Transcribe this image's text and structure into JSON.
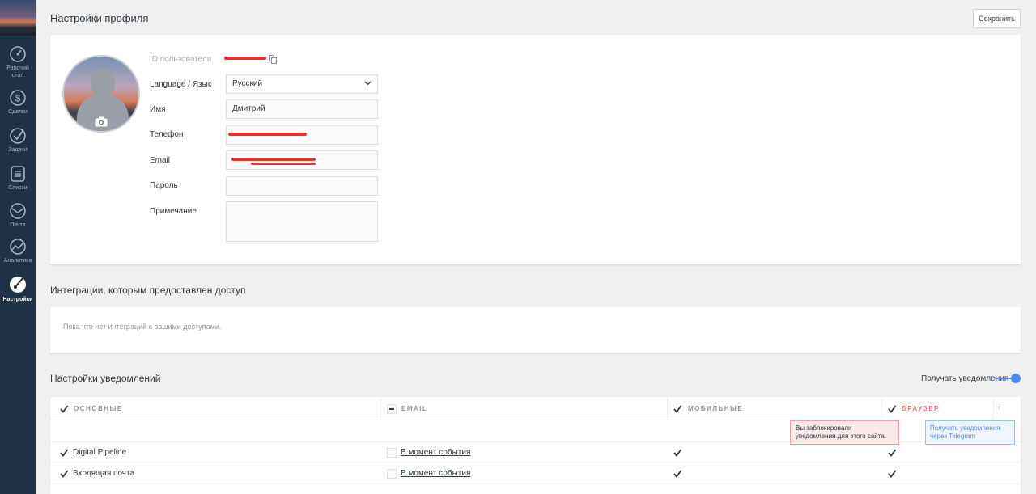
{
  "sidebar": {
    "items": [
      {
        "label_1": "Рабочий",
        "label_2": "стол",
        "icon": "speedometer-icon"
      },
      {
        "label": "Сделки",
        "icon": "dollar-icon"
      },
      {
        "label": "Задачи",
        "icon": "checkmark-icon"
      },
      {
        "label": "Списки",
        "icon": "list-icon"
      },
      {
        "label": "Почта",
        "icon": "mail-icon"
      },
      {
        "label": "Аналитика",
        "icon": "chart-icon"
      },
      {
        "label": "Настройки",
        "icon": "settings-icon",
        "active": true
      }
    ]
  },
  "header": {
    "title": "Настройки профиля",
    "save_label": "Сохранить"
  },
  "profile": {
    "id_label": "ID пользователя",
    "language_label": "Language / Язык",
    "language_value": "Русский",
    "name_label": "Имя",
    "name_value": "Дмитрий",
    "phone_label": "Телефон",
    "email_label": "Email",
    "password_label": "Пароль",
    "note_label": "Примечание"
  },
  "integrations": {
    "title": "Интеграции, которым предоставлен доступ",
    "empty_text": "Пока что нет интеграций с вашими доступами."
  },
  "notifications": {
    "title": "Настройки уведомлений",
    "toggle_label": "Получать уведомления",
    "toggle_on": true,
    "columns": [
      "ОСНОВНЫЕ",
      "EMAIL",
      "МОБИЛЬНЫЕ",
      "БРАУЗЕР"
    ],
    "blocked_tip": "Вы заблокировали уведомления для этого сайта.",
    "telegram_tip": "Получать уведомления через Telegram",
    "plus": "+",
    "rows": [
      {
        "name": "Digital Pipeline",
        "email_timing": "В момент события"
      },
      {
        "name": "Входящая почта",
        "email_timing": "В момент события"
      }
    ]
  },
  "colors": {
    "sidebar_bg": "#1d3147",
    "accent_blue": "#4c8bf7",
    "browser_red": "#f37575",
    "redaction": "#e8322a"
  }
}
